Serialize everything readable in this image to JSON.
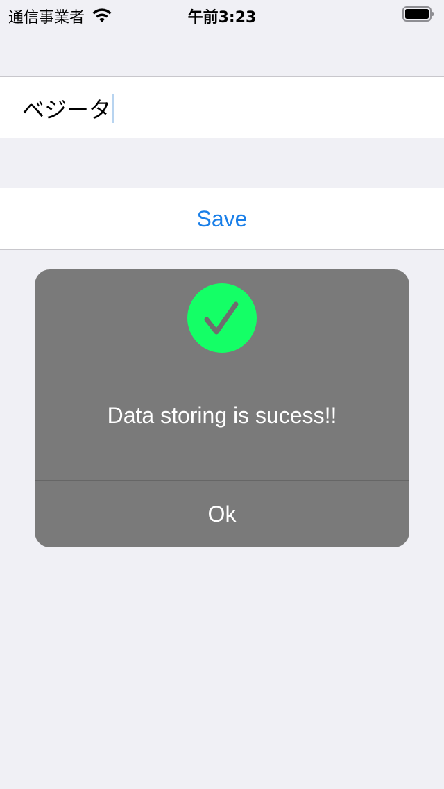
{
  "status_bar": {
    "carrier": "通信事業者",
    "time": "午前3:23",
    "icons": [
      "wifi-icon",
      "battery-icon"
    ]
  },
  "text_field": {
    "value": "ベジータ"
  },
  "save_button": {
    "label": "Save"
  },
  "alert": {
    "icon": "checkmark-icon",
    "message": "Data storing is sucess!!",
    "ok_label": "Ok"
  },
  "colors": {
    "background": "#f0f0f5",
    "accent": "#1a7fe8",
    "success_green": "#14ff66",
    "alert_background": "#7a7a7a"
  }
}
